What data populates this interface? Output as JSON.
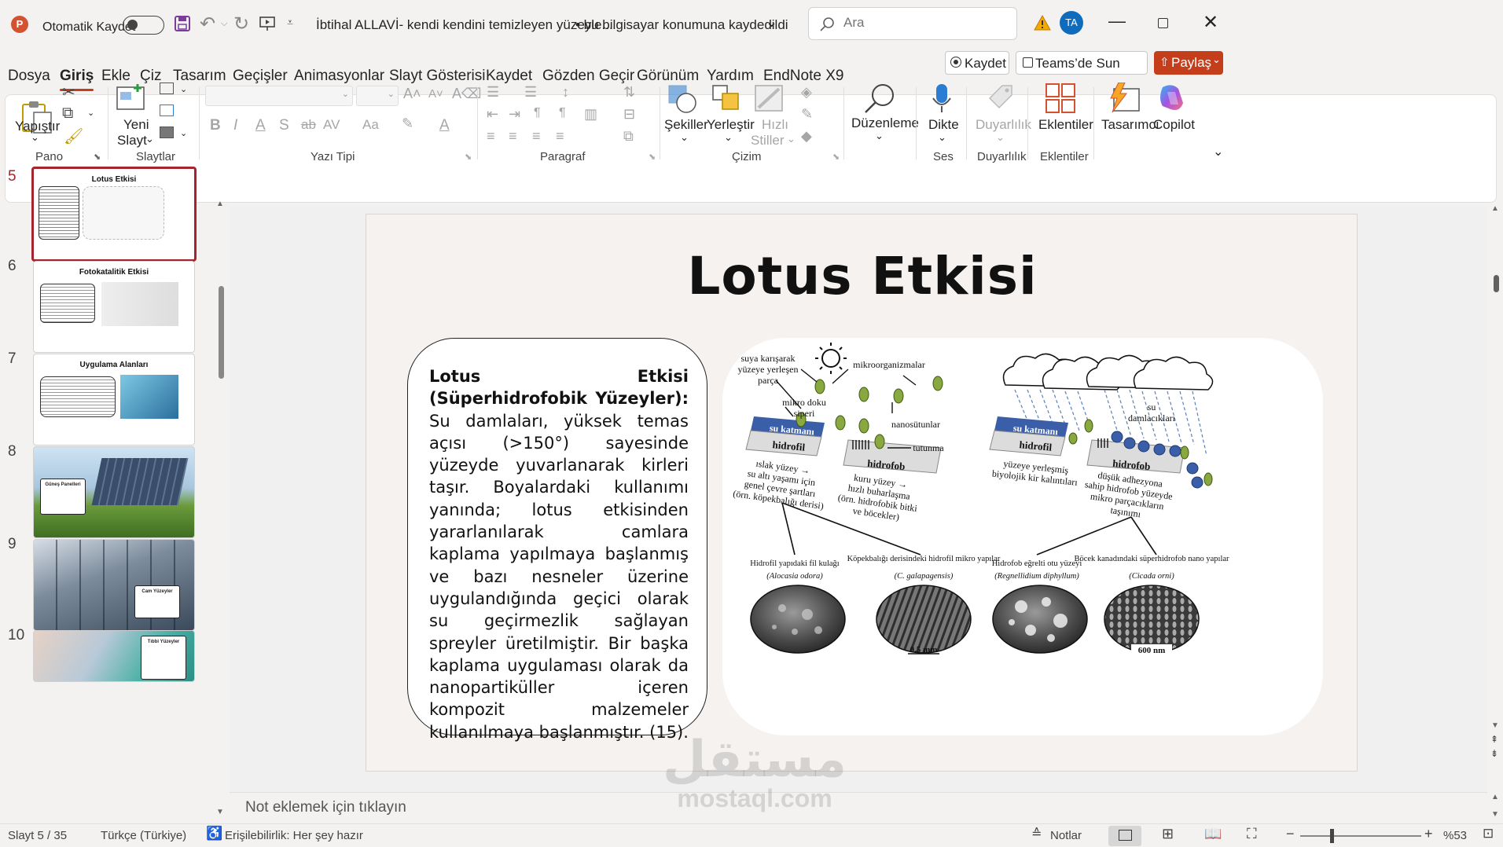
{
  "titlebar": {
    "autosave_label": "Otomatik Kaydet",
    "doc_title": "İbtihal ALLAVİ- kendi kendini temizleyen yüzeyle...",
    "save_status": "• bu bilgisayar konumuna kaydedildi",
    "search_placeholder": "Ara",
    "user_initials": "TA"
  },
  "menu": {
    "tabs": [
      "Dosya",
      "Giriş",
      "Ekle",
      "Çiz",
      "Tasarım",
      "Geçişler",
      "Animasyonlar",
      "Slayt Gösterisi",
      "Kaydet",
      "Gözden Geçir",
      "Görünüm",
      "Yardım",
      "EndNote X9"
    ],
    "record_button": "Kaydet",
    "teams_button": "Teams’de Sun",
    "share_button": "Paylaş"
  },
  "ribbon": {
    "paste": "Yapıştır",
    "new_slide_1": "Yeni",
    "new_slide_2": "Slayt",
    "shapes": "Şekiller",
    "arrange": "Yerleştir",
    "quick_styles_1": "Hızlı",
    "quick_styles_2": "Stiller",
    "editing": "Düzenleme",
    "dictate": "Dikte",
    "sensitivity": "Duyarlılık",
    "addins": "Eklentiler",
    "designer": "Tasarımcı",
    "copilot": "Copilot",
    "groups": {
      "clipboard": "Pano",
      "slides": "Slaytlar",
      "font": "Yazı Tipi",
      "paragraph": "Paragraf",
      "drawing": "Çizim",
      "voice": "Ses",
      "sensitivity": "Duyarlılık",
      "addins": "Eklentiler"
    }
  },
  "thumbnails": [
    {
      "num": "5",
      "title": "Lotus Etkisi",
      "selected": true
    },
    {
      "num": "6",
      "title": "Fotokatalitik Etkisi",
      "selected": false
    },
    {
      "num": "7",
      "title": "Uygulama Alanları",
      "selected": false
    },
    {
      "num": "8",
      "title": "",
      "caption": "Güneş Panelleri",
      "selected": false
    },
    {
      "num": "9",
      "title": "",
      "caption": "Cam Yüzeyler",
      "selected": false
    },
    {
      "num": "10",
      "title": "",
      "caption": "Tıbbi Yüzeyler",
      "selected": false
    }
  ],
  "slide": {
    "title": "Lotus Etkisi",
    "body_bold": "Lotus Etkisi (Süperhidrofobik Yüzeyler):",
    "body_text": " Su damlaları, yüksek temas açısı (>150°) sayesinde yüzeyde yuvarlanarak kirleri taşır. Boyalardaki kullanımı yanında; lotus etkisinden yararlanılarak camlara kaplama yapılmaya başlanmış ve bazı nesneler üzerine uygulandığında geçici olarak su geçirmezlik sağlayan spreyler üretilmiştir. Bir başka kaplama uygulaması olarak da nanopartiküller içeren kompozit malzemeler kullanılmaya başlanmıştır. (15).",
    "figure": {
      "labels_left": [
        "suya karışarak",
        "yüzeye yerleşen",
        "parça",
        "mikroorganizmalar",
        "mikro doku",
        "siperi",
        "su katmanı",
        "hidrofil",
        "nanosütunlar",
        "tutunma",
        "hidrofob",
        "ıslak yüzey →",
        "su altı yaşamı için",
        "genel çevre şartları",
        "(örn. köpekbalığı derisi)",
        "kuru yüzey →",
        "hızlı buharlaşma",
        "(örn. hidrofobik bitki",
        "ve böcekler)"
      ],
      "labels_right": [
        "su",
        "damlacıkları",
        "su katmanı",
        "hidrofil",
        "hidrofob",
        "yüzeye yerleşmiş",
        "biyolojik kir kalıntıları",
        "düşük adhezyona",
        "sahip hidrofob yüzeyde",
        "mikro parçacıkların",
        "taşınımı"
      ],
      "micrographs": [
        {
          "caption": "Hidrofil yapıdaki fil kulağı",
          "species": "(Alocasia odora)",
          "scale": ""
        },
        {
          "caption": "Köpekbalığı derisindeki hidrofil mikro yapılar",
          "species": "(C. galapagensis)",
          "scale": "0.5 mm"
        },
        {
          "caption": "Hidrofob eğrelti otu yüzeyi",
          "species": "(Regnellidium diphyllum)",
          "scale": ""
        },
        {
          "caption": "Böcek kanadındaki süperhidrofob nano yapılar",
          "species": "(Cicada orni)",
          "scale": "600 nm"
        }
      ]
    }
  },
  "notes_placeholder": "Not eklemek için tıklayın",
  "status": {
    "slide_count": "Slayt 5 / 35",
    "language": "Türkçe (Türkiye)",
    "accessibility": "Erişilebilirlik: Her şey hazır",
    "notes": "Notlar",
    "zoom": "%53"
  },
  "watermark": {
    "arabic": "مستقل",
    "latin": "mostaql.com"
  },
  "colors": {
    "accent": "#c43e1c",
    "selected_thumb": "#a4262c",
    "share": "#c43e1c"
  }
}
